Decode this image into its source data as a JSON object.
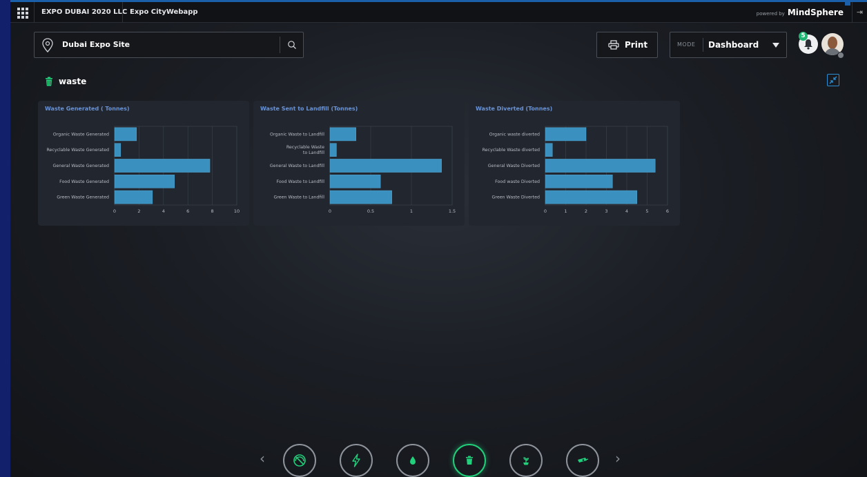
{
  "topbar": {
    "company": "EXPO DUBAI 2020 LLC",
    "app": "Expo CityWebapp",
    "powered_by": "powered by",
    "brand": "MindSphere"
  },
  "site": {
    "name": "Dubai Expo Site"
  },
  "toolbar": {
    "print_label": "Print",
    "mode_label": "MODE",
    "mode_value": "Dashboard"
  },
  "notifications": {
    "count": "5"
  },
  "section": {
    "title": "waste"
  },
  "colors": {
    "bar": "#3a91c0",
    "accent": "#21d07a",
    "title": "#6a93d6"
  },
  "chart_data": [
    {
      "type": "bar",
      "orientation": "horizontal",
      "title": "Waste Generated ( Tonnes)",
      "categories": [
        "Organic Waste Generated",
        "Recyclable Waste Generated",
        "General Waste Generated",
        "Food Waste Generated",
        "Green Waste Generated"
      ],
      "values": [
        1.8,
        0.5,
        7.8,
        4.9,
        3.1
      ],
      "xlim": [
        0,
        10
      ],
      "ticks": [
        "0",
        "2",
        "4",
        "6",
        "8",
        "10"
      ],
      "tick_values": [
        0,
        2,
        4,
        6,
        8,
        10
      ]
    },
    {
      "type": "bar",
      "orientation": "horizontal",
      "title": "Waste Sent to Landfill (Tonnes)",
      "categories": [
        "Organic Waste to Landfill",
        "Recyclable Waste to Landfill",
        "General Waste to Landfill",
        "Food Waste to Landfill",
        "Green Waste to Landfill"
      ],
      "values": [
        0.32,
        0.08,
        1.37,
        0.62,
        0.76
      ],
      "xlim": [
        0,
        1.5
      ],
      "ticks": [
        "0",
        "0.5",
        "1",
        "1.5"
      ],
      "tick_values": [
        0,
        0.5,
        1,
        1.5
      ]
    },
    {
      "type": "bar",
      "orientation": "horizontal",
      "title": "Waste Diverted (Tonnes)",
      "categories": [
        "Organic waste diverted",
        "Recyclable Waste diverted",
        "General Waste Diverted",
        "Food waste Diverted",
        "Green Waste Diverted"
      ],
      "values": [
        2.0,
        0.35,
        5.4,
        3.3,
        4.5
      ],
      "xlim": [
        0,
        6
      ],
      "ticks": [
        "0",
        "1",
        "2",
        "3",
        "4",
        "5",
        "6"
      ],
      "tick_values": [
        0,
        1,
        2,
        3,
        4,
        5,
        6
      ]
    }
  ],
  "bottom_nav": {
    "items": [
      {
        "icon": "speedometer-icon",
        "active": false
      },
      {
        "icon": "lightning-icon",
        "active": false
      },
      {
        "icon": "water-drop-icon",
        "active": false
      },
      {
        "icon": "trash-icon",
        "active": true
      },
      {
        "icon": "plant-icon",
        "active": false
      },
      {
        "icon": "cctv-camera-icon",
        "active": false
      }
    ]
  }
}
